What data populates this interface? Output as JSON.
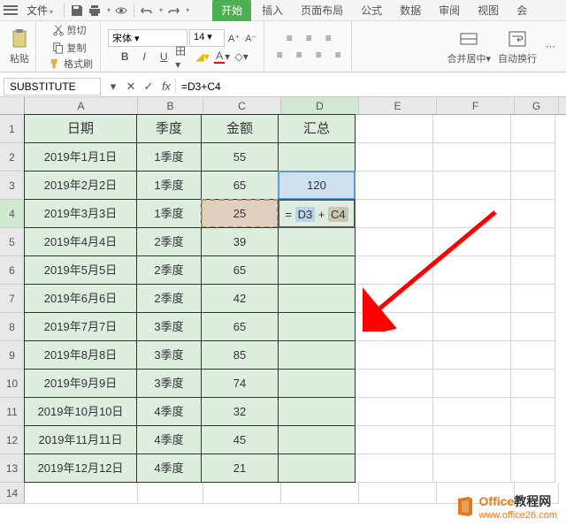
{
  "menu": {
    "file": "文件",
    "tabs": [
      "开始",
      "插入",
      "页面布局",
      "公式",
      "数据",
      "审阅",
      "视图",
      "会"
    ]
  },
  "ribbon": {
    "cut": "剪切",
    "copy": "复制",
    "format_painter": "格式刷",
    "paste": "粘贴",
    "font_name": "宋体",
    "font_size": "14",
    "merge": "合并居中",
    "wrap": "自动换行"
  },
  "formula_bar": {
    "name_box": "SUBSTITUTE",
    "formula": "=D3+C4"
  },
  "columns": [
    "A",
    "B",
    "C",
    "D",
    "E",
    "F",
    "G"
  ],
  "headers": {
    "A": "日期",
    "B": "季度",
    "C": "金额",
    "D": "汇总"
  },
  "rows": [
    {
      "n": 2,
      "A": "2019年1月1日",
      "B": "1季度",
      "C": "55",
      "D": ""
    },
    {
      "n": 3,
      "A": "2019年2月2日",
      "B": "1季度",
      "C": "65",
      "D": "120"
    },
    {
      "n": 4,
      "A": "2019年3月3日",
      "B": "1季度",
      "C": "25",
      "D": "= D3 + C4"
    },
    {
      "n": 5,
      "A": "2019年4月4日",
      "B": "2季度",
      "C": "39",
      "D": ""
    },
    {
      "n": 6,
      "A": "2019年5月5日",
      "B": "2季度",
      "C": "65",
      "D": ""
    },
    {
      "n": 7,
      "A": "2019年6月6日",
      "B": "2季度",
      "C": "42",
      "D": ""
    },
    {
      "n": 8,
      "A": "2019年7月7日",
      "B": "3季度",
      "C": "65",
      "D": ""
    },
    {
      "n": 9,
      "A": "2019年8月8日",
      "B": "3季度",
      "C": "85",
      "D": ""
    },
    {
      "n": 10,
      "A": "2019年9月9日",
      "B": "3季度",
      "C": "74",
      "D": ""
    },
    {
      "n": 11,
      "A": "2019年10月10日",
      "B": "4季度",
      "C": "32",
      "D": ""
    },
    {
      "n": 12,
      "A": "2019年11月11日",
      "B": "4季度",
      "C": "45",
      "D": ""
    },
    {
      "n": 13,
      "A": "2019年12月12日",
      "B": "4季度",
      "C": "21",
      "D": ""
    }
  ],
  "edit": {
    "prefix": "= ",
    "ref1": "D3",
    "plus": " + ",
    "ref2": "C4"
  },
  "watermark": {
    "t1": "Office",
    "t2": "教程网",
    "url": "www.office26.com"
  }
}
